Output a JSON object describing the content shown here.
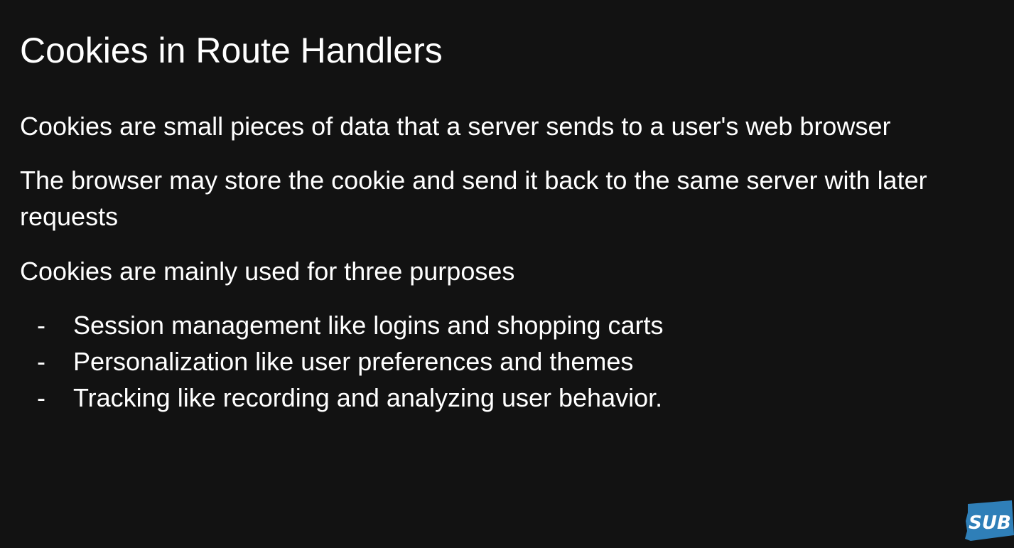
{
  "slide": {
    "title": "Cookies in Route Handlers",
    "paragraphs": [
      "Cookies are small pieces of data that a server sends to a user's web browser",
      "The browser may store the cookie and send it back to the same server with later requests",
      "Cookies are mainly used for three purposes"
    ],
    "bullet_marker": "-",
    "bullets": [
      "Session management like logins and shopping carts",
      "Personalization like user preferences and themes",
      "Tracking like recording and analyzing user behavior."
    ]
  },
  "badge": {
    "label": "SUB",
    "color": "#2f7fb8"
  },
  "colors": {
    "background": "#121212",
    "text": "#ffffff"
  }
}
